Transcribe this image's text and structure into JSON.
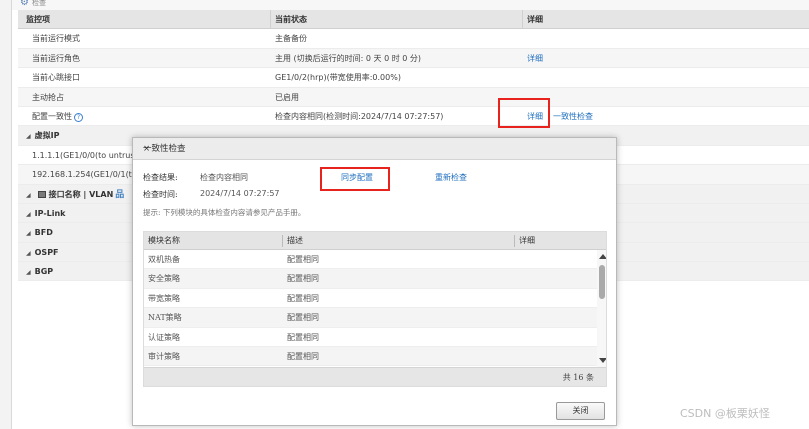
{
  "page": {
    "title": "检查",
    "watermark": "CSDN @板栗妖怪"
  },
  "table": {
    "headers": [
      "监控项",
      "当前状态",
      "详细"
    ],
    "rows": [
      {
        "item": "当前运行模式",
        "state": "主备备份",
        "detail": ""
      },
      {
        "item": "当前运行角色",
        "state": "主用 (切换后运行的时间: 0 天 0 时 0 分)",
        "detail": "详细"
      },
      {
        "item": "当前心跳接口",
        "state": "GE1/0/2(hrp)(带宽使用率:0.00%)",
        "detail": ""
      },
      {
        "item": "主动抢占",
        "state": "已启用",
        "detail": ""
      },
      {
        "item": "配置一致性",
        "state": "检查内容相同(检测时间:2024/7/14 07:27:57)",
        "detail": "详细",
        "detail2": "一致性检查"
      }
    ],
    "sections": {
      "vip": "虚拟IP",
      "vip_rows": [
        "1.1.1.1(GE1/0/0(to untrust)",
        "192.168.1.254(GE1/0/1(to"
      ],
      "iface": "接口名称 | VLAN",
      "others": [
        "IP-Link",
        "BFD",
        "OSPF",
        "BGP"
      ]
    }
  },
  "dialog": {
    "title": "一致性检查",
    "close_icon": "×",
    "result_label": "检查结果:",
    "result_value": "检查内容相同",
    "sync_link": "同步配置",
    "recheck_link": "重新检查",
    "time_label": "检查时间:",
    "time_value": "2024/7/14 07:27:57",
    "hint": "提示: 下列模块的具体检查内容请参见产品手册。",
    "columns": [
      "模块名称",
      "描述",
      "详细"
    ],
    "modules": [
      {
        "name": "双机热备",
        "desc": "配置相同"
      },
      {
        "name": "安全策略",
        "desc": "配置相同"
      },
      {
        "name": "带宽策略",
        "desc": "配置相同"
      },
      {
        "name": "NAT策略",
        "desc": "配置相同"
      },
      {
        "name": "认证策略",
        "desc": "配置相同"
      },
      {
        "name": "审计策略",
        "desc": "配置相同"
      }
    ],
    "total": "共 16 条",
    "close_button": "关闭"
  }
}
